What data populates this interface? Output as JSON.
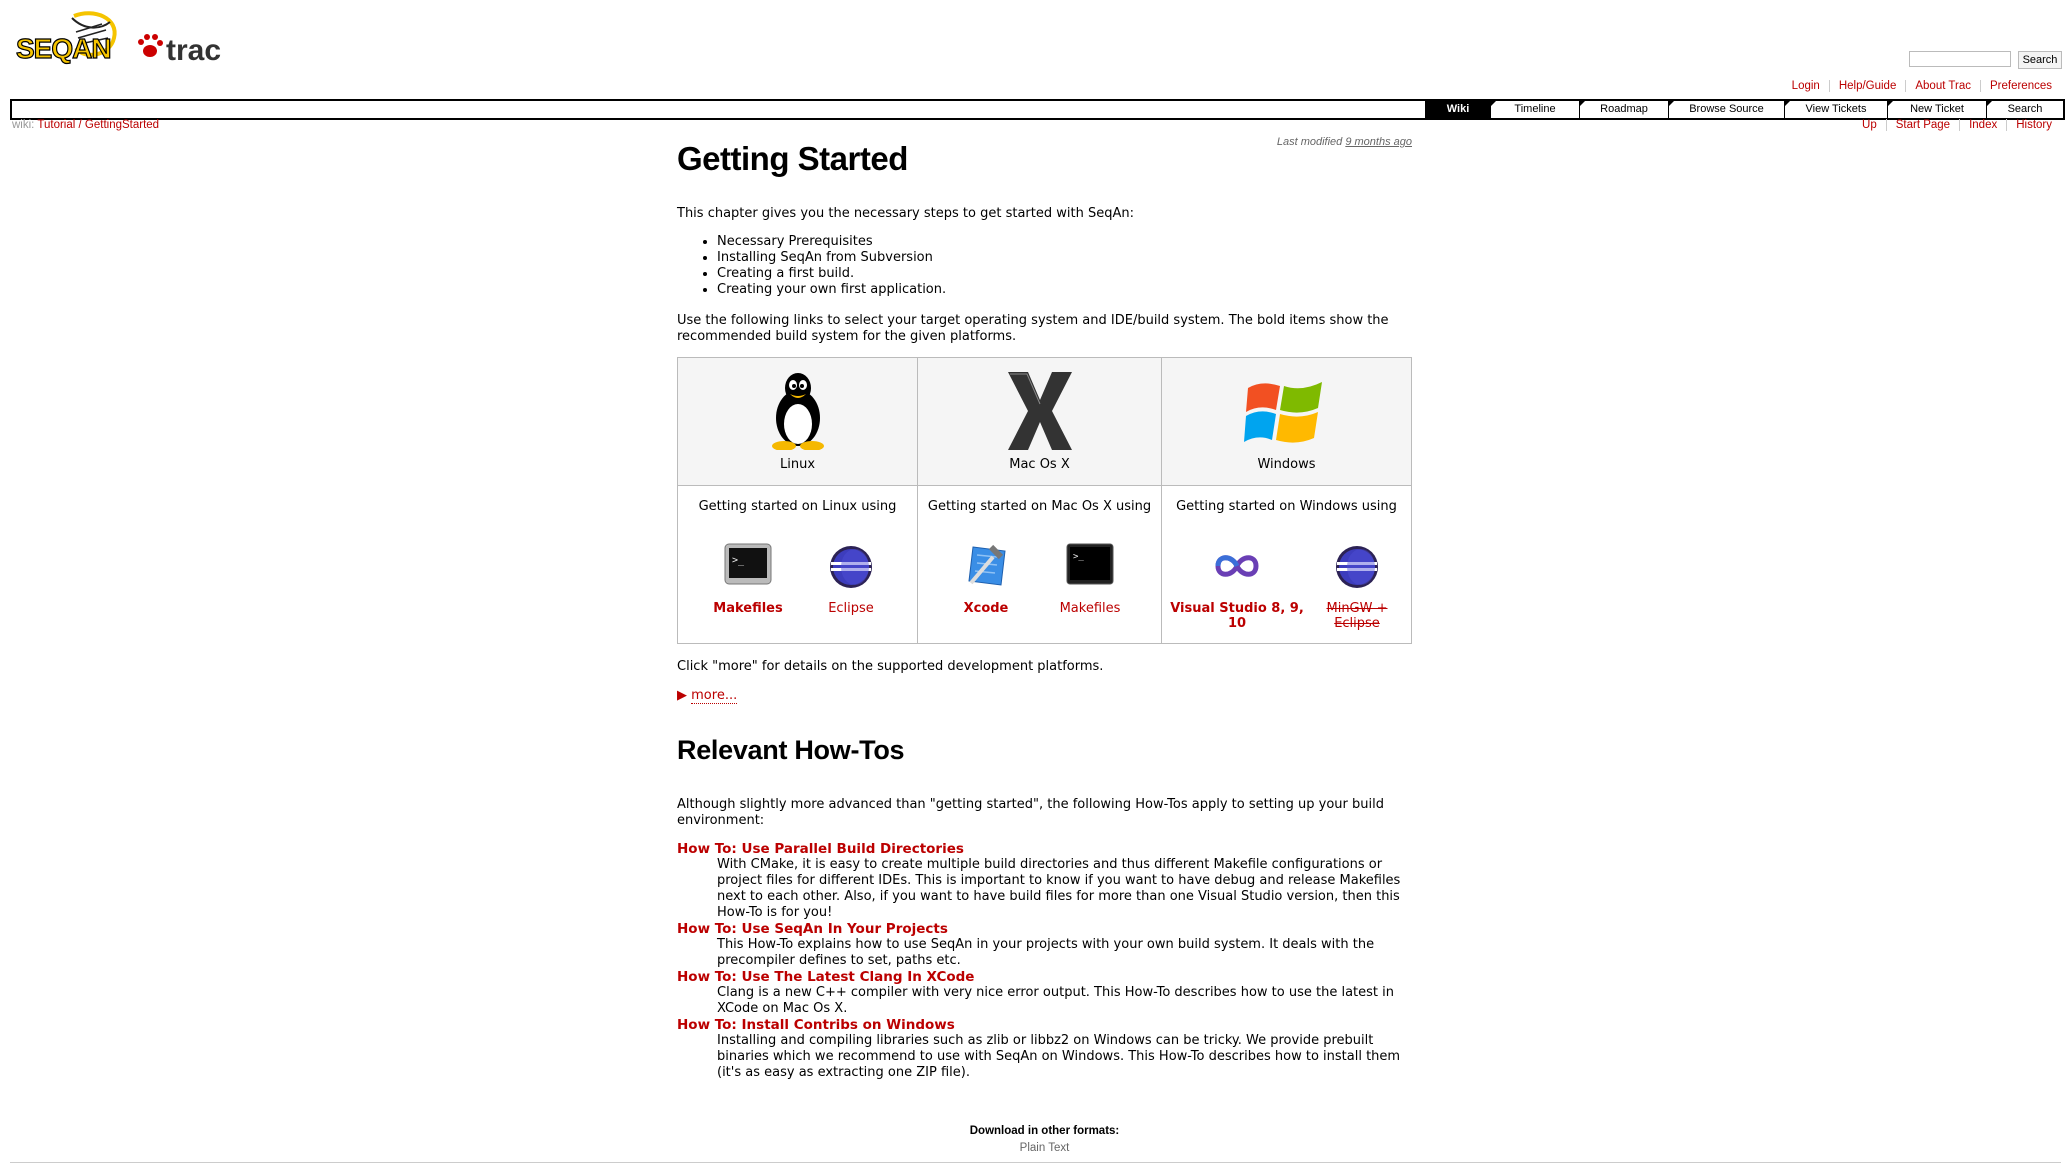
{
  "header": {
    "logo_text_seqan": "SEQAN",
    "logo_text_trac": "trac",
    "search_placeholder": "",
    "search_button": "Search",
    "metanav": [
      "Login",
      "Help/Guide",
      "About Trac",
      "Preferences"
    ]
  },
  "mainnav": {
    "tabs": [
      {
        "label": "Wiki",
        "active": true
      },
      {
        "label": "Timeline",
        "active": false
      },
      {
        "label": "Roadmap",
        "active": false
      },
      {
        "label": "Browse Source",
        "active": false
      },
      {
        "label": "View Tickets",
        "active": false
      },
      {
        "label": "New Ticket",
        "active": false
      },
      {
        "label": "Search",
        "active": false
      }
    ]
  },
  "breadcrumb": {
    "prefix": "wiki:",
    "part1": "Tutorial",
    "sep": "/",
    "part2": "GettingStarted"
  },
  "ctxtnav": [
    "Up",
    "Start Page",
    "Index",
    "History"
  ],
  "last_modified": {
    "text": "Last modified",
    "link": "9 months ago"
  },
  "page": {
    "title": "Getting Started",
    "intro": "This chapter gives you the necessary steps to get started with SeqAn:",
    "bullets": [
      "Necessary Prerequisites",
      "Installing SeqAn from Subversion",
      "Creating a first build.",
      "Creating your own first application."
    ],
    "links_intro": "Use the following links to select your target operating system and IDE/build system. The bold items show the recommended build system for the given platforms.",
    "platforms": [
      {
        "os": "Linux",
        "intro": "Getting started on Linux using",
        "tools": [
          {
            "label": "Makefiles",
            "icon": "terminal-icon"
          },
          {
            "label": "Eclipse",
            "icon": "eclipse-icon"
          }
        ]
      },
      {
        "os": "Mac Os X",
        "intro": "Getting started on Mac Os X using",
        "tools": [
          {
            "label": "Xcode",
            "icon": "xcode-icon"
          },
          {
            "label": "Makefiles",
            "icon": "terminal-icon"
          }
        ]
      },
      {
        "os": "Windows",
        "intro": "Getting started on Windows using",
        "tools": [
          {
            "label": "Visual Studio 8, 9, 10",
            "icon": "visual-studio-icon"
          },
          {
            "label": "MinGW + Eclipse",
            "icon": "eclipse-icon"
          }
        ]
      }
    ],
    "more_note": "Click \"more\" for details on the supported development platforms.",
    "more_link": "more...",
    "howtos_title": "Relevant How-Tos",
    "howtos_intro": "Although slightly more advanced than \"getting started\", the following How-Tos apply to setting up your build environment:",
    "howtos": [
      {
        "title": "How To: Use Parallel Build Directories",
        "desc": "With CMake, it is easy to create multiple build directories and thus different Makefile configurations or project files for different IDEs. This is important to know if you want to have debug and release Makefiles next to each other. Also, if you want to have build files for more than one Visual Studio version, then this How-To is for you!"
      },
      {
        "title": "How To: Use SeqAn In Your Projects",
        "desc": "This How-To explains how to use SeqAn in your projects with your own build system. It deals with the precompiler defines to set, paths etc."
      },
      {
        "title": "How To: Use The Latest Clang In XCode",
        "desc": "Clang is a new C++ compiler with very nice error output. This How-To describes how to use the latest in XCode on Mac Os X."
      },
      {
        "title": "How To: Install Contribs on Windows",
        "desc": "Installing and compiling libraries such as zlib or libbz2 on Windows can be tricky. We provide prebuilt binaries which we recommend to use with SeqAn on Windows. This How-To describes how to install them (it's as easy as extracting one ZIP file)."
      }
    ],
    "download_label": "Download in other formats:",
    "download_link": "Plain Text"
  },
  "colors": {
    "link": "#bb0000",
    "nav_active_bg": "#000000",
    "table_head_bg": "#f5f5f5"
  }
}
